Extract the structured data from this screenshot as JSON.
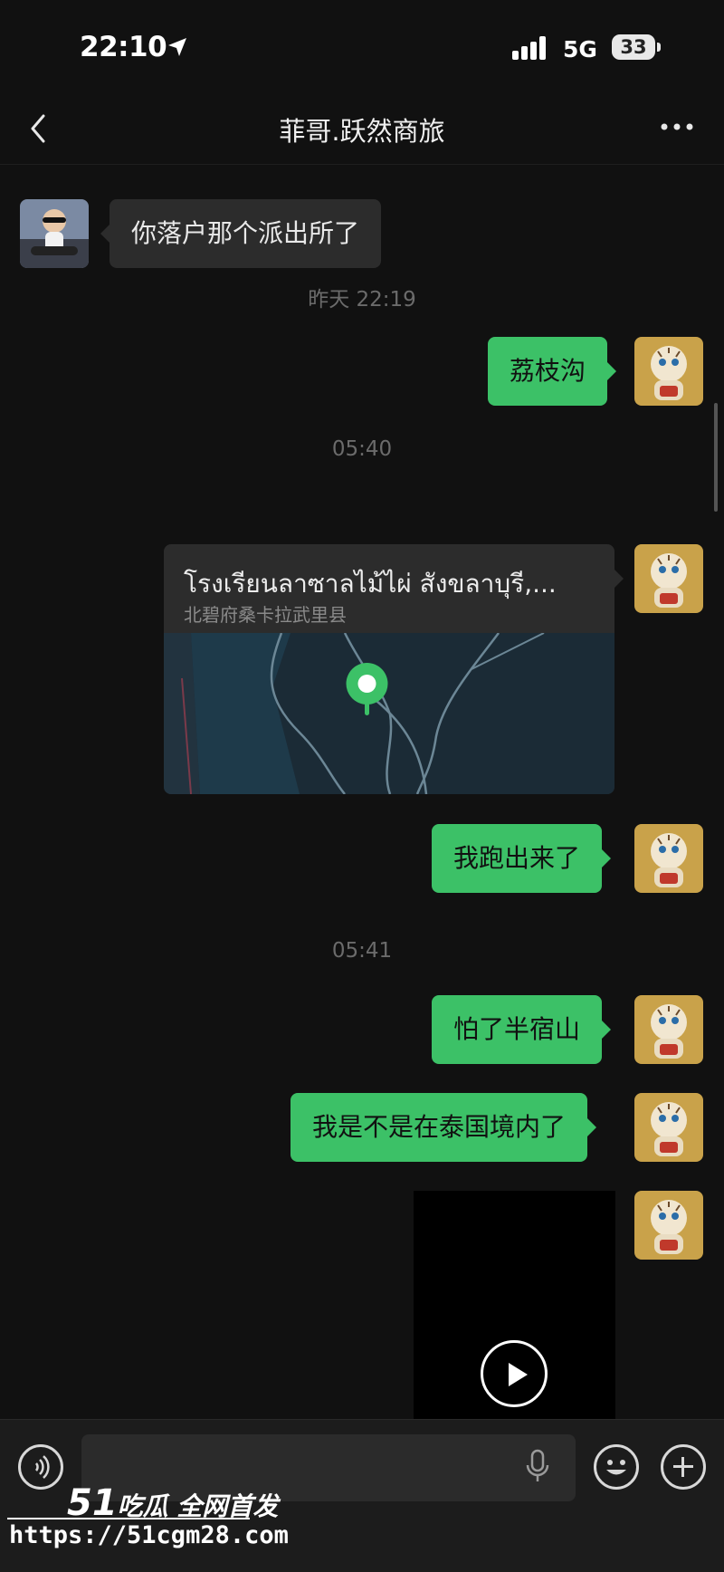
{
  "status_bar": {
    "time": "22:10",
    "network": "5G",
    "battery": "33",
    "icons": [
      "location-arrow-icon",
      "signal-bars-icon"
    ]
  },
  "nav": {
    "title": "菲哥.跃然商旅",
    "back_icon": "chevron-left-icon",
    "more_icon": "more-dots-icon"
  },
  "messages": [
    {
      "type": "text",
      "direction": "in",
      "text": "你落户那个派出所了"
    },
    {
      "type": "timestamp",
      "text": "昨天 22:19"
    },
    {
      "type": "text",
      "direction": "out",
      "text": "荔枝沟"
    },
    {
      "type": "timestamp",
      "text": "05:40"
    },
    {
      "type": "location",
      "direction": "out",
      "title": "โรงเรียนลาซาลไม้ไผ่ สังขลาบุรี,...",
      "subtitle": "北碧府桑卡拉武里县"
    },
    {
      "type": "text",
      "direction": "out",
      "text": "我跑出来了"
    },
    {
      "type": "timestamp",
      "text": "05:41"
    },
    {
      "type": "text",
      "direction": "out",
      "text": "怕了半宿山"
    },
    {
      "type": "text",
      "direction": "out",
      "text": "我是不是在泰国境内了"
    },
    {
      "type": "video",
      "direction": "out",
      "icon": "play-icon"
    }
  ],
  "input_bar": {
    "placeholder": "",
    "icons": [
      "voice-icon",
      "microphone-icon",
      "emoji-icon",
      "plus-icon"
    ]
  },
  "watermark": {
    "brand_number": "51",
    "brand_text": "吃瓜 全网首发",
    "url": "https://51cgm28.com"
  },
  "colors": {
    "background": "#111111",
    "outgoing_bubble": "#3cc167",
    "incoming_bubble": "#2c2c2c",
    "map_pin": "#3cc167"
  }
}
